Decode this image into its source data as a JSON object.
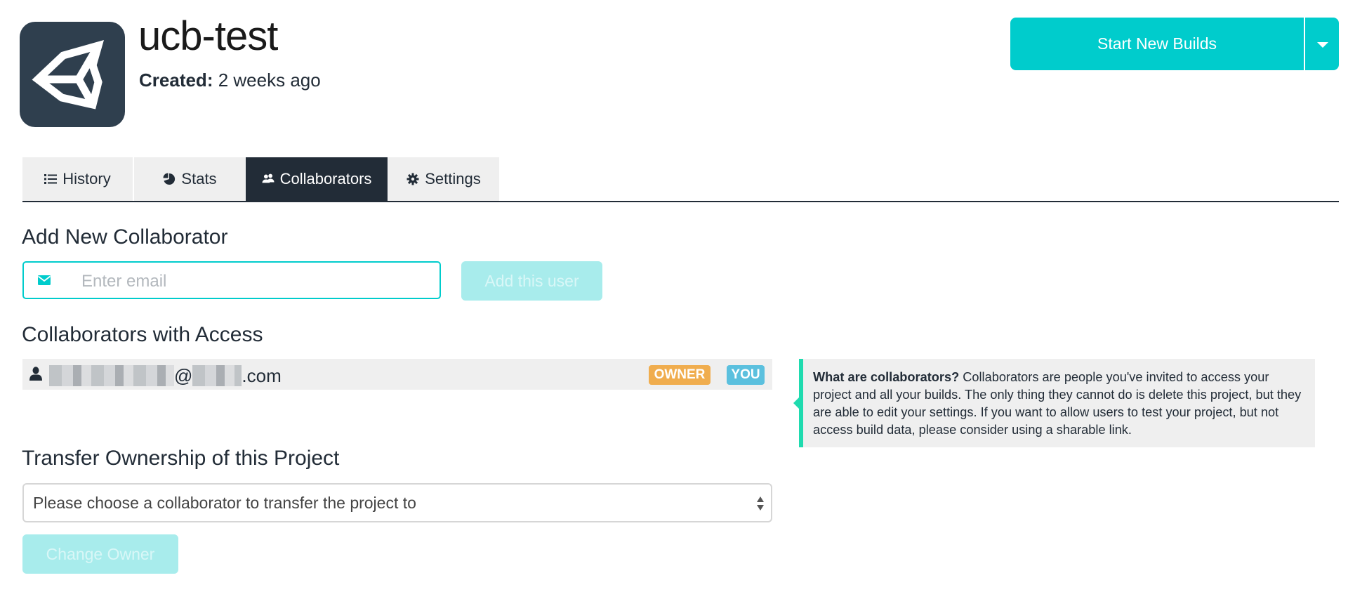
{
  "header": {
    "project_name": "ucb-test",
    "created_label": "Created:",
    "created_value": "2 weeks ago",
    "logo_icon": "unity-logo-icon",
    "start_builds_label": "Start New Builds",
    "start_builds_dropdown_icon": "caret-down-icon"
  },
  "tabs": [
    {
      "label": "History",
      "icon": "list-icon",
      "active": false
    },
    {
      "label": "Stats",
      "icon": "pie-chart-icon",
      "active": false
    },
    {
      "label": "Collaborators",
      "icon": "users-icon",
      "active": true
    },
    {
      "label": "Settings",
      "icon": "gear-icon",
      "active": false
    }
  ],
  "add_collaborator": {
    "heading": "Add New Collaborator",
    "email_placeholder": "Enter email",
    "email_value": "",
    "email_icon": "envelope-icon",
    "add_button_label": "Add this user"
  },
  "collaborators_with_access": {
    "heading": "Collaborators with Access",
    "list": [
      {
        "email_at": "@",
        "email_suffix": ".com",
        "email_redacted": true,
        "badges": [
          "OWNER",
          "YOU"
        ]
      }
    ]
  },
  "help_tip": {
    "title": "What are collaborators?",
    "body": "Collaborators are people you've invited to access your project and all your builds. The only thing they cannot do is delete this project, but they are able to edit your settings. If you want to allow users to test your project, but not access build data, please consider using a sharable link."
  },
  "transfer_ownership": {
    "heading": "Transfer Ownership of this Project",
    "select_placeholder": "Please choose a collaborator to transfer the project to",
    "change_owner_label": "Change Owner"
  },
  "colors": {
    "accent": "#00cccc",
    "accent_disabled": "#a8ecec",
    "dark": "#222c37",
    "owner_badge": "#f0ad4e",
    "you_badge": "#5bc0de",
    "tip_border": "#1fdbaf"
  }
}
